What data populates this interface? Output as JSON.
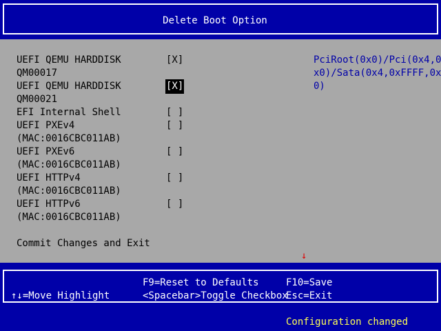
{
  "header": {
    "title": "Delete Boot Option"
  },
  "options": [
    {
      "line1": "UEFI QEMU HARDDISK",
      "line2": "QM00017",
      "checkbox": "[X]",
      "selected": false
    },
    {
      "line1": "UEFI QEMU HARDDISK",
      "line2": "QM00021",
      "checkbox": "[X]",
      "selected": true
    },
    {
      "line1": "EFI Internal Shell",
      "line2": "",
      "checkbox": "[ ]",
      "selected": false
    },
    {
      "line1": "UEFI PXEv4",
      "line2": "(MAC:0016CBC011AB)",
      "checkbox": "[ ]",
      "selected": false
    },
    {
      "line1": "UEFI PXEv6",
      "line2": "(MAC:0016CBC011AB)",
      "checkbox": "[ ]",
      "selected": false
    },
    {
      "line1": "UEFI HTTPv4",
      "line2": "(MAC:0016CBC011AB)",
      "checkbox": "[ ]",
      "selected": false
    },
    {
      "line1": "UEFI HTTPv6",
      "line2": "(MAC:0016CBC011AB)",
      "checkbox": "[ ]",
      "selected": false
    }
  ],
  "commit_label": "Commit Changes and Exit",
  "help_text": [
    "PciRoot(0x0)/Pci(0x4,0",
    "x0)/Sata(0x4,0xFFFF,0x",
    "0)"
  ],
  "scroll_indicator": "↓",
  "footer": {
    "move_highlight": "↑↓=Move Highlight",
    "reset_defaults": "F9=Reset to Defaults",
    "toggle_checkbox": "<Spacebar>Toggle Checkbox",
    "save": "F10=Save",
    "exit": "Esc=Exit"
  },
  "status": "Configuration changed",
  "colors": {
    "header_bg": "#0000a8",
    "panel_bg": "#a8a8a8",
    "help_text": "#0000a8",
    "status_text": "#ffff54",
    "scroll_arrow": "#e00000"
  }
}
